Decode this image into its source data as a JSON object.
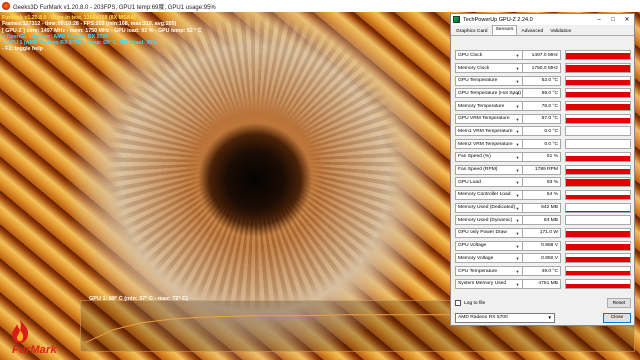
{
  "furmark": {
    "title": "Geeks3D FurMark v1.20.8.0 - 203FPS, GPU1 temp:69度, GPU1 usage:95%",
    "osd": [
      {
        "text": "FurMark v1.20.8.0 - Burn-in test, 1366x768 (8X MSAA)",
        "color": "yellow"
      },
      {
        "text": "Frames:127312 - time:00:10:28 - FPS:203 (min:168, max:210, avg:205)",
        "color": "white"
      },
      {
        "text": "[ GPU-Z ] core: 1497 MHz - mem: 1750 MHz - GPU load: 93 % - GPU temp: 52 ° C",
        "color": "white"
      },
      {
        "text": "> OpenGL renderer: AMD Radeon RX 5700",
        "color": "cyan"
      },
      {
        "text": "> GPU 1 (AMD Radeon RX 5700) - temp: 69° C, GPU load: 95%",
        "color": "cyan"
      },
      {
        "text": "- F1: toggle help",
        "color": "white"
      }
    ],
    "graph_label": "GPU 1: 69° C (min: 37° C - max: 72° C)",
    "temp_series": [
      37,
      52,
      60,
      64,
      66,
      67,
      68,
      68,
      68,
      69,
      69,
      69,
      69,
      69,
      69,
      69,
      69,
      69,
      69,
      69
    ],
    "temp_range": [
      30,
      80
    ],
    "logo": "FurMark"
  },
  "gpuz": {
    "title": "TechPowerUp GPU-Z 2.24.0",
    "window_buttons": [
      "–",
      "□",
      "✕"
    ],
    "tabs": [
      "Graphics Card",
      "Sensors",
      "Advanced",
      "Validation"
    ],
    "active_tab": "Sensors",
    "sensors": [
      {
        "label": "GPU Clock",
        "value": "1497.0 MHz",
        "level": 0.85
      },
      {
        "label": "Memory Clock",
        "value": "1750.0 MHz",
        "level": 0.85
      },
      {
        "label": "GPU Temperature",
        "value": "52.0 °C",
        "level": 0.55
      },
      {
        "label": "GPU Temperature (Hot Spot)",
        "value": "69.0 °C",
        "level": 0.7
      },
      {
        "label": "Memory Temperature",
        "value": "78.0 °C",
        "level": 0.75
      },
      {
        "label": "GPU VRM Temperature",
        "value": "57.0 °C",
        "level": 0.6
      },
      {
        "label": "Mem1 VRM Temperature",
        "value": "0.0 °C",
        "level": 0
      },
      {
        "label": "Mem2 VRM Temperature",
        "value": "0.0 °C",
        "level": 0
      },
      {
        "label": "Fan Speed (%)",
        "value": "51 %",
        "level": 0.55
      },
      {
        "label": "Fan Speed (RPM)",
        "value": "1789 RPM",
        "level": 0.55
      },
      {
        "label": "GPU Load",
        "value": "93 %",
        "level": 0.93
      },
      {
        "label": "Memory Controller Load",
        "value": "54 %",
        "level": 0.54
      },
      {
        "label": "Memory Used (Dedicated)",
        "value": "642 MB",
        "level": 0.1
      },
      {
        "label": "Memory Used (Dynamic)",
        "value": "84 MB",
        "level": 0.05
      },
      {
        "label": "GPU only Power Draw",
        "value": "171.0 W",
        "level": 0.8
      },
      {
        "label": "GPU Voltage",
        "value": "0.968 V",
        "level": 0.7
      },
      {
        "label": "Memory Voltage",
        "value": "0.850 V",
        "level": 0.65
      },
      {
        "label": "CPU Temperature",
        "value": "49.0 °C",
        "level": 0.5
      },
      {
        "label": "System Memory Used",
        "value": "4761 MB",
        "level": 0.5
      }
    ],
    "log_to_file": "Log to file",
    "reset_label": "Reset",
    "gpu_select": "AMD Radeon RX 5700",
    "close_label": "Close"
  }
}
